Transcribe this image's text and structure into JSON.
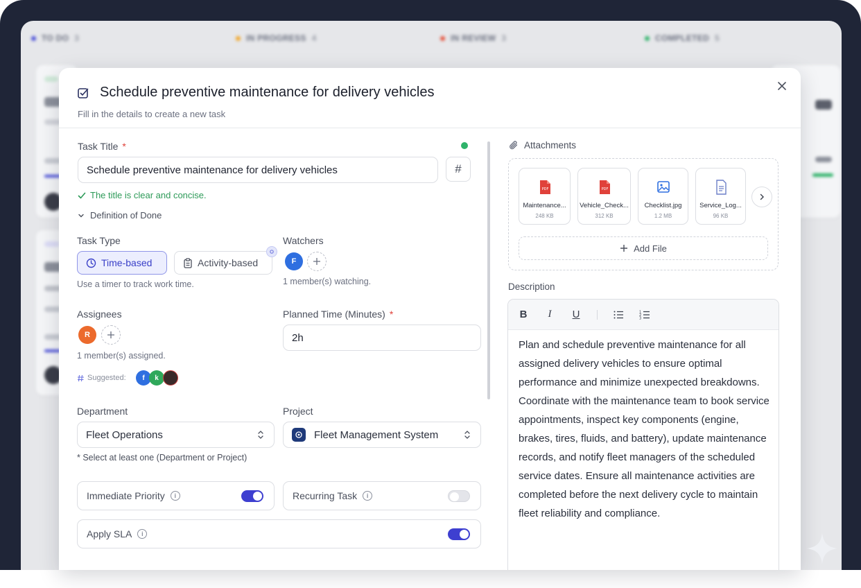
{
  "board": {
    "columns": [
      {
        "label": "TO DO",
        "count": "3",
        "color": "#4b50d8"
      },
      {
        "label": "IN PROGRESS",
        "count": "4",
        "color": "#f2a627"
      },
      {
        "label": "IN REVIEW",
        "count": "3",
        "color": "#e5533d"
      },
      {
        "label": "COMPLETED",
        "count": "5",
        "color": "#2fb36a"
      }
    ]
  },
  "modal": {
    "title": "Schedule preventive maintenance for delivery vehicles",
    "subtitle": "Fill in the details to create a new task"
  },
  "form": {
    "task_title_label": "Task Title",
    "required_mark": "*",
    "task_title_value": "Schedule preventive maintenance for delivery vehicles",
    "hash_label": "#",
    "validation_message": "The title is clear and concise.",
    "definition_of_done": "Definition of Done",
    "task_type_label": "Task Type",
    "task_type_options": [
      "Time-based",
      "Activity-based"
    ],
    "task_type_selected": "Time-based",
    "task_type_hint": "Use a timer to track work time.",
    "watchers_label": "Watchers",
    "watcher_initial": "F",
    "watchers_count": "1 member(s) watching.",
    "assignees_label": "Assignees",
    "assignee_initial": "R",
    "assignees_count": "1 member(s) assigned.",
    "suggested_label": "Suggested:",
    "suggested_initials": [
      "f",
      "k"
    ],
    "planned_time_label": "Planned Time (Minutes)",
    "planned_time_value": "2h",
    "department_label": "Department",
    "department_value": "Fleet Operations",
    "project_label": "Project",
    "project_value": "Fleet Management System",
    "select_hint": "* Select at least one (Department or Project)",
    "immediate_priority_label": "Immediate Priority",
    "immediate_priority_on": true,
    "recurring_task_label": "Recurring Task",
    "recurring_task_on": false,
    "apply_sla_label": "Apply SLA",
    "apply_sla_on": true
  },
  "attachments": {
    "label": "Attachments",
    "files": [
      {
        "name": "Maintenance...",
        "size": "248 KB",
        "icon": "pdf-icon"
      },
      {
        "name": "Vehicle_Check...",
        "size": "312 KB",
        "icon": "pdf-icon"
      },
      {
        "name": "Checklist.jpg",
        "size": "1.2 MB",
        "icon": "image-icon"
      },
      {
        "name": "Service_Log...",
        "size": "96 KB",
        "icon": "doc-icon"
      }
    ],
    "add_file_label": "Add File"
  },
  "description": {
    "label": "Description",
    "text": "Plan and schedule preventive maintenance for all assigned delivery vehicles to ensure optimal performance and minimize unexpected breakdowns. Coordinate with the maintenance team to book service appointments, inspect key components (engine, brakes, tires, fluids, and battery), update maintenance records, and notify fleet managers of the scheduled service dates. Ensure all maintenance activities are completed before the next delivery cycle to maintain fleet reliability and compliance."
  },
  "colors": {
    "accent": "#3e3fd0",
    "success": "#2fb36a",
    "pdf": "#e0413a",
    "assignee_avatar": "#ec6a2c",
    "watcher_avatar": "#2f6fe0"
  }
}
